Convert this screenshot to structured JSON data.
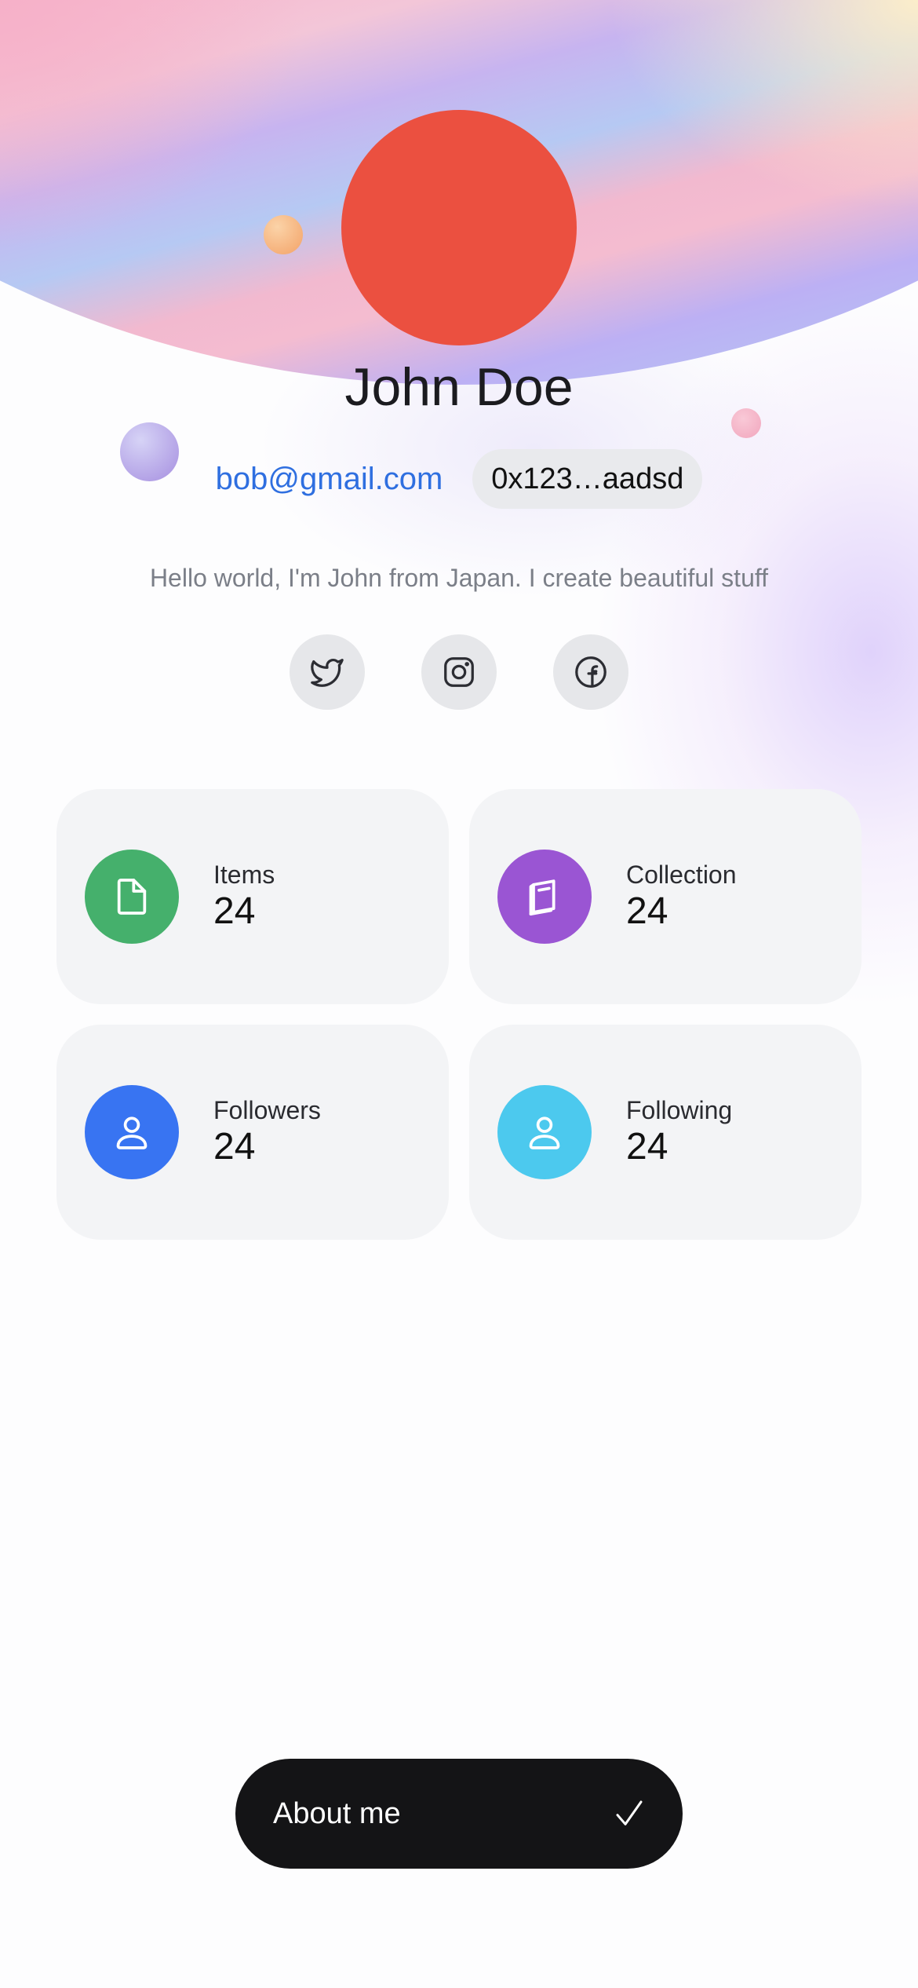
{
  "profile": {
    "name": "John Doe",
    "email": "bob@gmail.com",
    "wallet": "0x123…aadsd",
    "bio": "Hello world, I'm John from Japan. I create beautiful stuff",
    "avatar_color": "#eb5040"
  },
  "socials": [
    {
      "icon": "twitter-icon"
    },
    {
      "icon": "instagram-icon"
    },
    {
      "icon": "facebook-icon"
    }
  ],
  "stats": [
    {
      "label": "Items",
      "value": "24",
      "icon": "file-icon",
      "color": "#45b06c"
    },
    {
      "label": "Collection",
      "value": "24",
      "icon": "book-icon",
      "color": "#9a55d3"
    },
    {
      "label": "Followers",
      "value": "24",
      "icon": "user-icon",
      "color": "#3874f2"
    },
    {
      "label": "Following",
      "value": "24",
      "icon": "user-icon",
      "color": "#4cc9ee"
    }
  ],
  "cta": {
    "label": "About me",
    "icon": "check-icon"
  },
  "colors": {
    "link": "#2f6fe0",
    "card_bg": "#f3f4f6",
    "button_bg": "#141416"
  }
}
